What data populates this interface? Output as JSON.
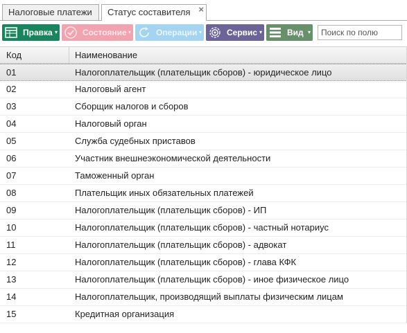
{
  "tabs": [
    {
      "label": "Налоговые платежи"
    },
    {
      "label": "Статус составителя",
      "close": "×"
    }
  ],
  "toolbar": {
    "edit_label": "Правка",
    "state_label": "Состояние",
    "operations_label": "Операции",
    "service_label": "Сервис",
    "view_label": "Вид",
    "caret": "▾",
    "search_placeholder": "Поиск по полю",
    "colors": {
      "edit": "#19855f",
      "state": "#f2a3b0",
      "operations": "#a4d4ef",
      "service": "#6c6497",
      "view": "#67906b"
    }
  },
  "table": {
    "headers": {
      "code": "Код",
      "name": "Наименование"
    },
    "rows": [
      {
        "code": "01",
        "name": "Налогоплательщик (плательщик сборов) - юридическое лицо"
      },
      {
        "code": "02",
        "name": "Налоговый агент"
      },
      {
        "code": "03",
        "name": "Сборщик налогов и сборов"
      },
      {
        "code": "04",
        "name": "Налоговый орган"
      },
      {
        "code": "05",
        "name": "Служба судебных приставов"
      },
      {
        "code": "06",
        "name": "Участник внешнеэкономической деятельности"
      },
      {
        "code": "07",
        "name": "Таможенный орган"
      },
      {
        "code": "08",
        "name": "Плательщик иных обязательных платежей"
      },
      {
        "code": "09",
        "name": "Налогоплательщик (плательщик сборов) - ИП"
      },
      {
        "code": "10",
        "name": "Налогоплательщик (плательщик сборов) - частный нотариус"
      },
      {
        "code": "11",
        "name": "Налогоплательщик (плательщик сборов) - адвокат"
      },
      {
        "code": "12",
        "name": "Налогоплательщик (плательщик сборов) - глава КФК"
      },
      {
        "code": "13",
        "name": "Налогоплательщик (плательщик сборов) - иное физическое лицо"
      },
      {
        "code": "14",
        "name": "Налогоплательщик, производящий выплаты физическим лицам"
      },
      {
        "code": "15",
        "name": "Кредитная организация"
      }
    ]
  }
}
